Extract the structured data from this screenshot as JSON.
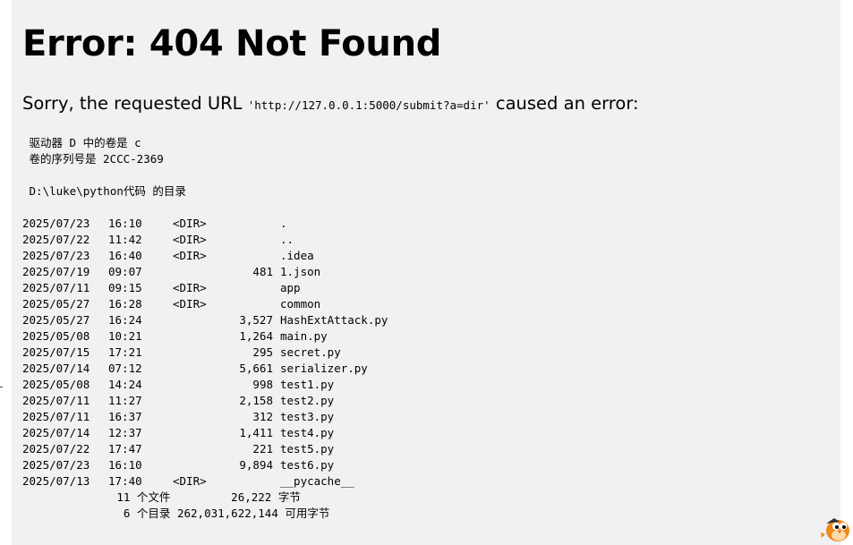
{
  "error": {
    "title": "Error: 404 Not Found",
    "msg_prefix": "Sorry, the requested URL ",
    "url": "'http://127.0.0.1:5000/submit?a=dir'",
    "msg_suffix": " caused an error:"
  },
  "listing": {
    "volume": " 驱动器 D 中的卷是 c",
    "serial": " 卷的序列号是 2CCC-2369",
    "dir_line": " D:\\luke\\python代码 的目录",
    "entries": [
      {
        "date": "2025/07/23",
        "time": "16:10",
        "dir": "<DIR>",
        "size": "",
        "name": "."
      },
      {
        "date": "2025/07/22",
        "time": "11:42",
        "dir": "<DIR>",
        "size": "",
        "name": ".."
      },
      {
        "date": "2025/07/23",
        "time": "16:40",
        "dir": "<DIR>",
        "size": "",
        "name": ".idea"
      },
      {
        "date": "2025/07/19",
        "time": "09:07",
        "dir": "",
        "size": "481",
        "name": "1.json"
      },
      {
        "date": "2025/07/11",
        "time": "09:15",
        "dir": "<DIR>",
        "size": "",
        "name": "app"
      },
      {
        "date": "2025/05/27",
        "time": "16:28",
        "dir": "<DIR>",
        "size": "",
        "name": "common"
      },
      {
        "date": "2025/05/27",
        "time": "16:24",
        "dir": "",
        "size": "3,527",
        "name": "HashExtAttack.py"
      },
      {
        "date": "2025/05/08",
        "time": "10:21",
        "dir": "",
        "size": "1,264",
        "name": "main.py"
      },
      {
        "date": "2025/07/15",
        "time": "17:21",
        "dir": "",
        "size": "295",
        "name": "secret.py"
      },
      {
        "date": "2025/07/14",
        "time": "07:12",
        "dir": "",
        "size": "5,661",
        "name": "serializer.py"
      },
      {
        "date": "2025/05/08",
        "time": "14:24",
        "dir": "",
        "size": "998",
        "name": "test1.py"
      },
      {
        "date": "2025/07/11",
        "time": "11:27",
        "dir": "",
        "size": "2,158",
        "name": "test2.py"
      },
      {
        "date": "2025/07/11",
        "time": "16:37",
        "dir": "",
        "size": "312",
        "name": "test3.py"
      },
      {
        "date": "2025/07/14",
        "time": "12:37",
        "dir": "",
        "size": "1,411",
        "name": "test4.py"
      },
      {
        "date": "2025/07/22",
        "time": "17:47",
        "dir": "",
        "size": "221",
        "name": "test5.py"
      },
      {
        "date": "2025/07/23",
        "time": "16:10",
        "dir": "",
        "size": "9,894",
        "name": "test6.py"
      },
      {
        "date": "2025/07/13",
        "time": "17:40",
        "dir": "<DIR>",
        "size": "",
        "name": "__pycache__"
      }
    ],
    "files_summary": "              11 个文件         26,222 字节",
    "dirs_summary": "               6 个目录 262,031,622,144 可用字节"
  },
  "colors": {
    "page_bg": "#f1f1f4",
    "mascot_orange": "#f08a1d"
  },
  "icons": {
    "mascot": "bird-mascot-icon"
  }
}
